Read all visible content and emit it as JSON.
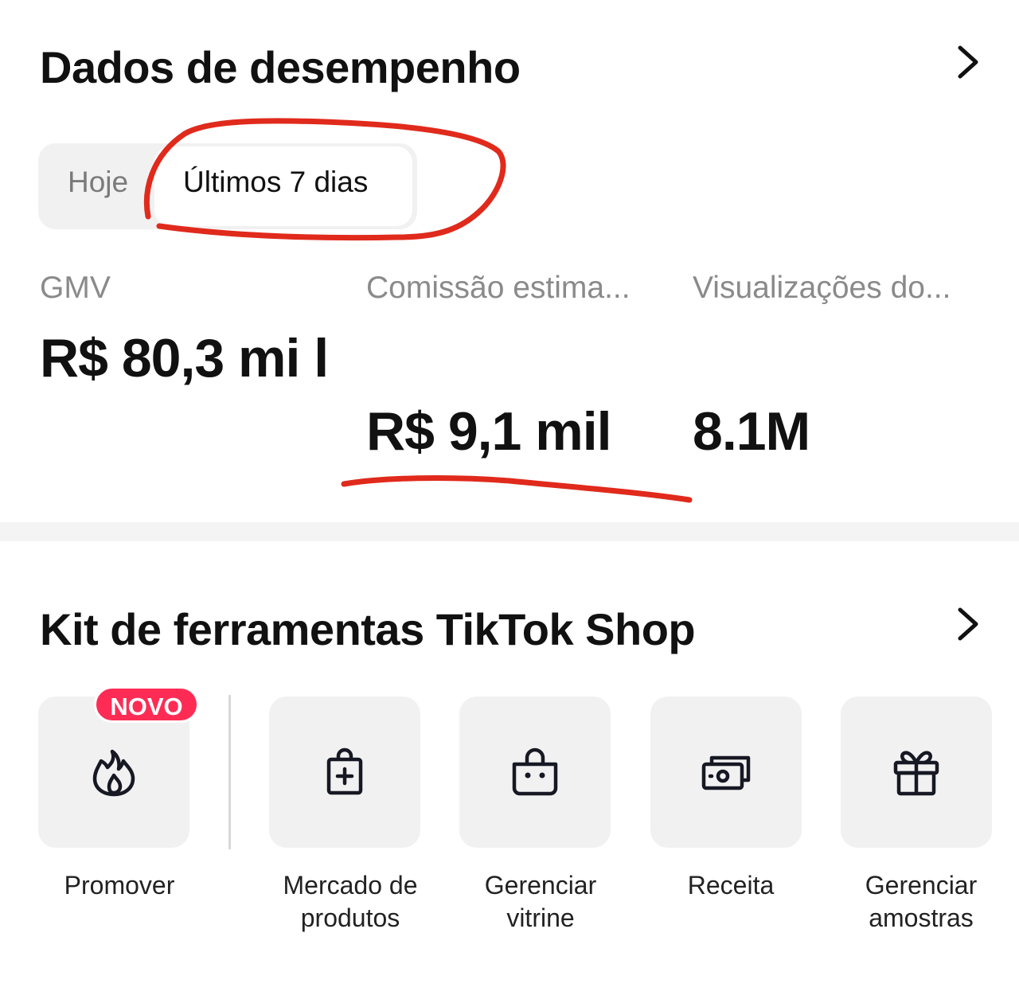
{
  "performance": {
    "title": "Dados de desempenho",
    "tabs": [
      {
        "label": "Hoje",
        "selected": false
      },
      {
        "label": "Últimos 7 dias",
        "selected": true
      }
    ],
    "metrics": [
      {
        "label": "GMV",
        "value": "R$ 80,3 mi l"
      },
      {
        "label": "Comissão estima...",
        "value": "R$ 9,1 mil"
      },
      {
        "label": "Visualizações do...",
        "value": "8.1M"
      }
    ]
  },
  "toolkit": {
    "title": "Kit de ferramentas TikTok Shop",
    "items": [
      {
        "label_line1": "Promover",
        "label_line2": "",
        "icon": "flame-icon",
        "badge": "NOVO"
      },
      {
        "label_line1": "Mercado de",
        "label_line2": "produtos",
        "icon": "shopping-bag-plus-icon"
      },
      {
        "label_line1": "Gerenciar",
        "label_line2": "vitrine",
        "icon": "basket-icon"
      },
      {
        "label_line1": "Receita",
        "label_line2": "",
        "icon": "money-icon"
      },
      {
        "label_line1": "Gerenciar",
        "label_line2": "amostras",
        "icon": "gift-icon"
      }
    ]
  },
  "colors": {
    "accent_badge": "#fe2c55",
    "annotation": "#e02a1c",
    "tile_bg": "#f1f1f2"
  }
}
